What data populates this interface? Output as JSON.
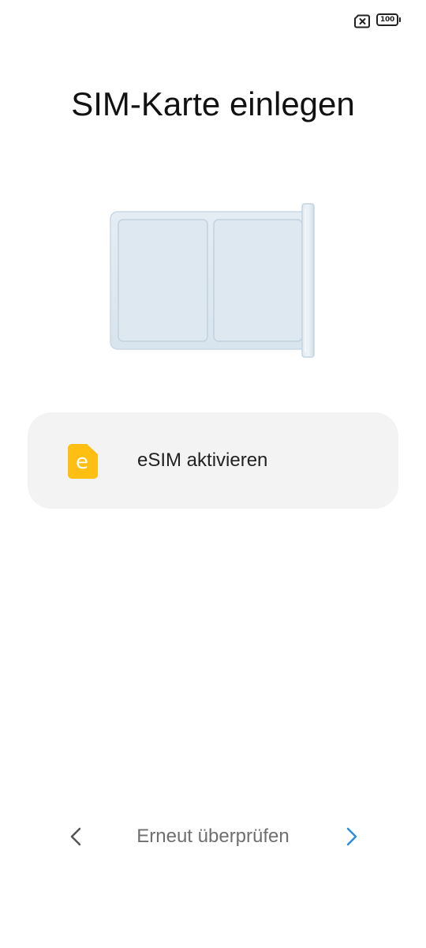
{
  "status_bar": {
    "sim_icon": "no-sim-icon",
    "battery_level": "100"
  },
  "title": "SIM-Karte einlegen",
  "illustration": {
    "icon": "sim-tray-icon"
  },
  "esim_option": {
    "icon": "esim-icon",
    "icon_letter": "e",
    "label": "eSIM aktivieren",
    "accent_color": "#FFBE12"
  },
  "bottom_nav": {
    "back_icon": "chevron-left-icon",
    "center_label": "Erneut überprüfen",
    "next_icon": "chevron-right-icon",
    "next_color": "#2A8EE0"
  }
}
